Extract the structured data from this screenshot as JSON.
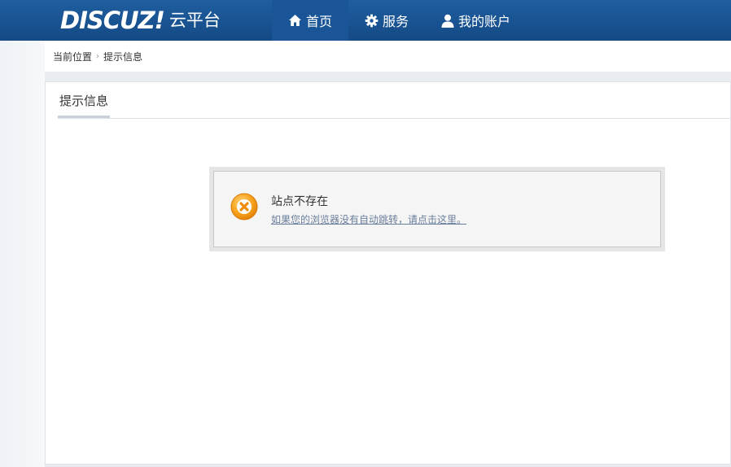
{
  "header": {
    "logo_mark": "DISCUZ!",
    "logo_sub": "云平台",
    "nav": [
      {
        "label": "首页",
        "icon": "home-icon"
      },
      {
        "label": "服务",
        "icon": "gear-icon"
      },
      {
        "label": "我的账户",
        "icon": "user-icon"
      }
    ],
    "colors": {
      "bar": "#1a5697",
      "active": "#1a5697"
    }
  },
  "breadcrumb": {
    "root": "当前位置",
    "current": "提示信息"
  },
  "panel": {
    "tab": "提示信息",
    "message": {
      "title": "站点不存在",
      "link": "如果您的浏览器没有自动跳转，请点击这里。",
      "icon": "error-x-icon"
    }
  }
}
